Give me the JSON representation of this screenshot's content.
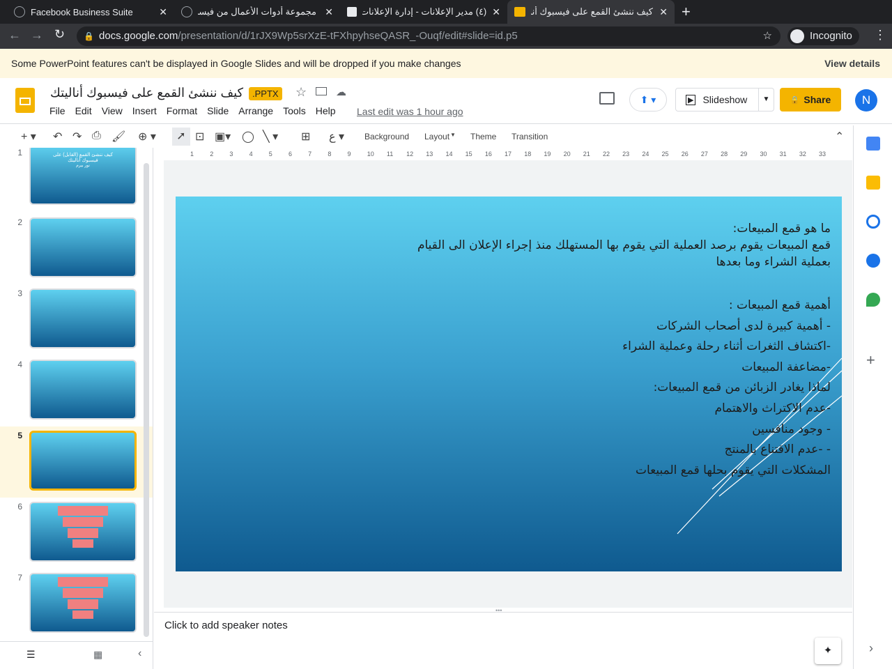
{
  "browser": {
    "tabs": [
      {
        "title": "Facebook Business Suite"
      },
      {
        "title": "مجموعة أدوات الأعمال من فيسبوك"
      },
      {
        "title": "(٤) مدير الإعلانات - إدارة الإعلانات"
      },
      {
        "title": "كيف ننشئ القمع على فيسبوك أناليتك"
      }
    ],
    "url_host": "docs.google.com",
    "url_path": "/presentation/d/1rJX9Wp5srXzE-tFXhpyhseQASR_-Ouqf/edit#slide=id.p5",
    "incognito": "Incognito"
  },
  "warning": {
    "text": "Some PowerPoint features can't be displayed in Google Slides and will be dropped if you make changes",
    "action": "View details"
  },
  "doc": {
    "title": "كيف ننشئ القمع على فيسبوك أناليتك",
    "badge": ".PPTX",
    "last_edit": "Last edit was 1 hour ago",
    "menu": [
      "File",
      "Edit",
      "View",
      "Insert",
      "Format",
      "Slide",
      "Arrange",
      "Tools",
      "Help"
    ],
    "slideshow": "Slideshow",
    "share": "Share",
    "avatar": "N"
  },
  "toolbar": {
    "background": "Background",
    "layout": "Layout",
    "theme": "Theme",
    "transition": "Transition"
  },
  "ruler": [
    "1",
    "2",
    "3",
    "4",
    "5",
    "6",
    "7",
    "8",
    "9",
    "10",
    "11",
    "12",
    "13",
    "14",
    "15",
    "16",
    "17",
    "18",
    "19",
    "20",
    "21",
    "22",
    "23",
    "24",
    "25",
    "26",
    "27",
    "28",
    "29",
    "30",
    "31",
    "32",
    "33"
  ],
  "filmstrip": {
    "slides": [
      "1",
      "2",
      "3",
      "4",
      "5",
      "6",
      "7"
    ],
    "slide1_title": "كيف ننشئ القمع (القابل) على فيسبوك أناليتك",
    "slide1_sub": "نور بيرم"
  },
  "slide": {
    "lines": [
      "ما هو قمع المبيعات:",
      "قمع المبيعات يقوم برصد العملية التي يقوم بها المستهلك منذ إجراء الإعلان الى القيام بعملية الشراء وما بعدها",
      "",
      "أهمية قمع المبيعات :",
      "- أهمية كبيرة لدى أصحاب الشركات",
      "-اكتشاف الثغرات أثناء رحلة وعملية الشراء",
      "-مضاعفة المبيعات",
      "لماذا يغادر الزبائن من قمع المبيعات:",
      "-عدم الاكتراث والاهتمام",
      "-   وجود منافسين",
      "-   -عدم الاقتناع بالمنتج",
      "المشكلات التي يقوم بحلها قمع المبيعات"
    ]
  },
  "notes": {
    "placeholder": "Click to add speaker notes"
  },
  "colors": {
    "accent": "#f4b400",
    "slide_top": "#5ed0ef",
    "slide_bottom": "#0f5a8f"
  }
}
